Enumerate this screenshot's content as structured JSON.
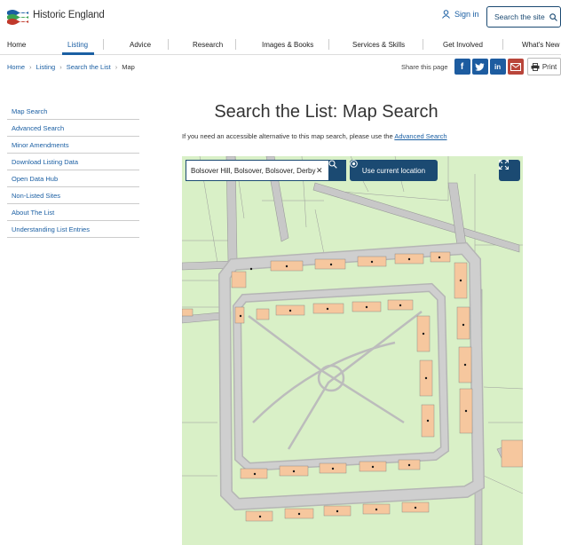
{
  "header": {
    "brand": "Historic England",
    "signin": "Sign in",
    "search_site": "Search the site"
  },
  "nav": {
    "items": [
      "Home",
      "Listing",
      "Advice",
      "Research",
      "Images & Books",
      "Services & Skills",
      "Get Involved",
      "What's New"
    ],
    "active": "Listing"
  },
  "breadcrumb": [
    "Home",
    "Listing",
    "Search the List",
    "Map"
  ],
  "share": {
    "label": "Share this page",
    "print": "Print"
  },
  "sidebar": {
    "items": [
      "Map Search",
      "Advanced Search",
      "Minor Amendments",
      "Download Listing Data",
      "Open Data Hub",
      "Non-Listed Sites",
      "About The List",
      "Understanding List Entries"
    ]
  },
  "main": {
    "title": "Search the List: Map Search",
    "intro_text": "If you need an accessible alternative to this map search, please use the",
    "intro_link": "Advanced Search"
  },
  "map": {
    "search_value": "Bolsover Hill, Bolsover, Bolsover, Derby",
    "locate_label": "Use current location"
  },
  "colors": {
    "accent": "#1b5fa3",
    "button": "#1b4a72",
    "map_green": "#d9f0c7",
    "map_road": "#c8c8c8",
    "listed_building": "#f6c79e"
  }
}
